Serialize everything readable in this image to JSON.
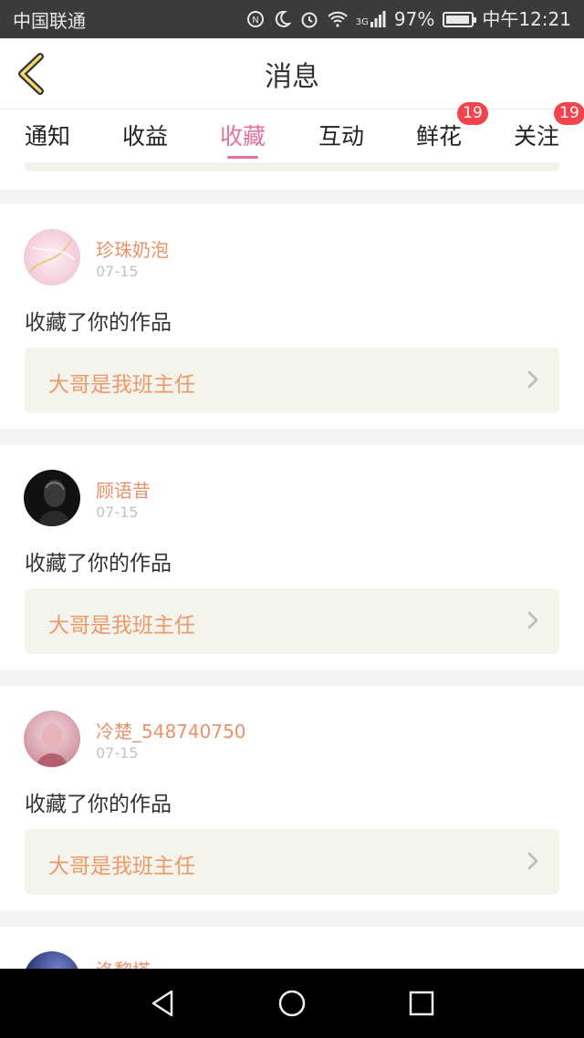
{
  "status_bar": {
    "carrier": "中国联通",
    "battery_percent": "97%",
    "time": "中午12:21",
    "network": "3G",
    "icons": [
      "nfc-icon",
      "moon-icon",
      "alarm-icon",
      "wifi-icon",
      "signal-icon",
      "battery-icon"
    ]
  },
  "header": {
    "title": "消息"
  },
  "tabs": [
    {
      "label": "通知",
      "badge": ""
    },
    {
      "label": "收益",
      "badge": ""
    },
    {
      "label": "收藏",
      "badge": "",
      "active": true
    },
    {
      "label": "互动",
      "badge": ""
    },
    {
      "label": "鲜花",
      "badge": "19"
    },
    {
      "label": "关注",
      "badge": "19"
    }
  ],
  "feed": [
    {
      "user": "珍珠奶泡",
      "date": "07-15",
      "action": "收藏了你的作品",
      "work_title": "大哥是我班主任"
    },
    {
      "user": "顾语昔",
      "date": "07-15",
      "action": "收藏了你的作品",
      "work_title": "大哥是我班主任"
    },
    {
      "user": "冷楚_548740750",
      "date": "07-15",
      "action": "收藏了你的作品",
      "work_title": "大哥是我班主任"
    },
    {
      "user": "洛黎塔"
    }
  ],
  "colors": {
    "accent_pink": "#e2739e",
    "username_orange": "#e9926b",
    "work_title_orange": "#ec9a6a",
    "badge_red": "#f2444c"
  },
  "nav": {
    "icons": [
      "back-triangle-icon",
      "home-circle-icon",
      "recents-square-icon"
    ]
  }
}
